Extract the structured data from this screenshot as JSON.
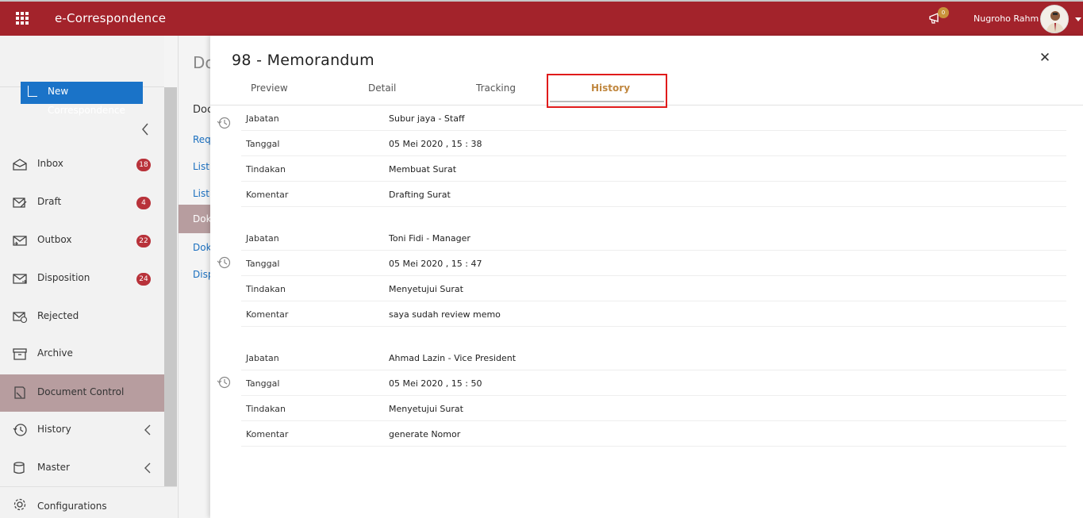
{
  "header": {
    "app_title": "e-Correspondence",
    "notification_count": "0",
    "user_name": "Nugroho Rahm",
    "icons": {
      "menu": "grid-icon",
      "notifications": "megaphone-icon",
      "user": "avatar"
    },
    "brand_color": "#a3232b"
  },
  "sidebar": {
    "new_button_label": "New Correspondence",
    "items": [
      {
        "label": "Inbox",
        "icon": "inbox-icon",
        "badge": "18"
      },
      {
        "label": "Draft",
        "icon": "draft-icon",
        "badge": "4"
      },
      {
        "label": "Outbox",
        "icon": "outbox-icon",
        "badge": "22"
      },
      {
        "label": "Disposition",
        "icon": "disposition-icon",
        "badge": "24"
      },
      {
        "label": "Rejected",
        "icon": "rejected-icon",
        "badge": ""
      },
      {
        "label": "Archive",
        "icon": "archive-icon",
        "badge": ""
      },
      {
        "label": "Document Control",
        "icon": "document-control-icon",
        "badge": "",
        "active": true
      },
      {
        "label": "History",
        "icon": "history-icon",
        "badge": "",
        "expandable": true
      },
      {
        "label": "Master",
        "icon": "master-icon",
        "badge": "",
        "expandable": true
      },
      {
        "label": "Configurations",
        "icon": "gear-icon",
        "badge": ""
      }
    ]
  },
  "background_page": {
    "title": "Do",
    "subtitle": "Doc",
    "links": [
      "Requ",
      "List",
      "List",
      "Doku",
      "Doku",
      "Disp"
    ]
  },
  "panel": {
    "title": "98 - Memorandum",
    "tabs": [
      "Preview",
      "Detail",
      "Tracking",
      "History"
    ],
    "active_tab": "History",
    "history": [
      {
        "fields": [
          {
            "key": "Jabatan",
            "value": "Subur jaya - Staff"
          },
          {
            "key": "Tanggal",
            "value": "05 Mei 2020 , 15 : 38"
          },
          {
            "key": "Tindakan",
            "value": "Membuat Surat"
          },
          {
            "key": "Komentar",
            "value": "Drafting Surat"
          }
        ]
      },
      {
        "fields": [
          {
            "key": "Jabatan",
            "value": "Toni Fidi - Manager"
          },
          {
            "key": "Tanggal",
            "value": "05 Mei 2020 , 15 : 47"
          },
          {
            "key": "Tindakan",
            "value": "Menyetujui Surat"
          },
          {
            "key": "Komentar",
            "value": "saya sudah review memo"
          }
        ]
      },
      {
        "fields": [
          {
            "key": "Jabatan",
            "value": "Ahmad Lazin - Vice President"
          },
          {
            "key": "Tanggal",
            "value": "05 Mei 2020 , 15 : 50"
          },
          {
            "key": "Tindakan",
            "value": "Menyetujui Surat"
          },
          {
            "key": "Komentar",
            "value": "generate Nomor"
          }
        ]
      }
    ]
  }
}
